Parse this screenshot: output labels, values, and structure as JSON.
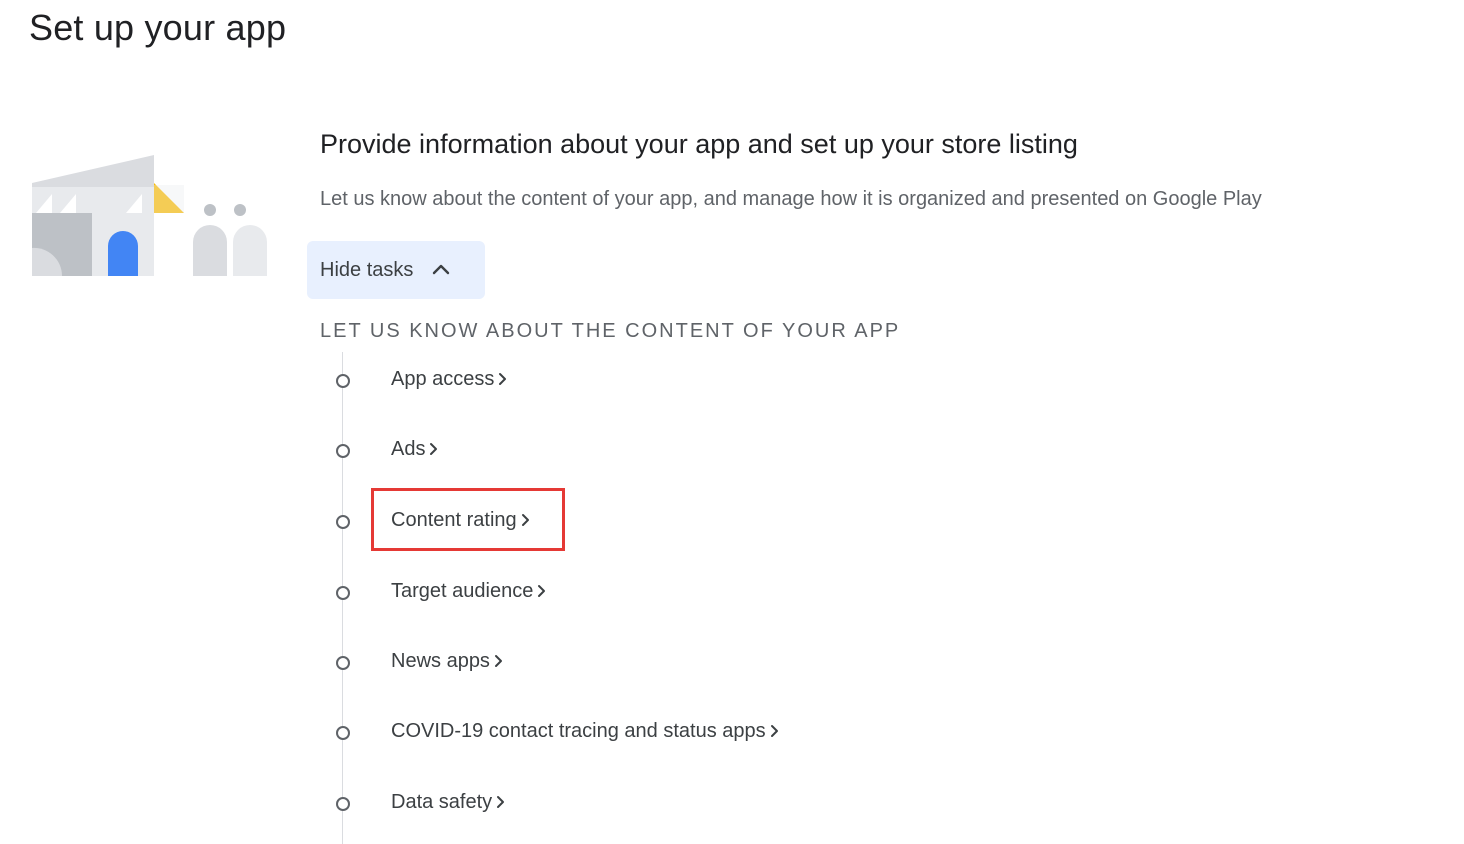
{
  "page": {
    "title": "Set up your app"
  },
  "section": {
    "heading": "Provide information about your app and set up your store listing",
    "description": "Let us know about the content of your app, and manage how it is organized and presented on Google Play",
    "hide_tasks_label": "Hide tasks",
    "hide_tasks_icon": "chevron-up-icon",
    "task_group_title": "LET US KNOW ABOUT THE CONTENT OF YOUR APP"
  },
  "tasks": [
    {
      "label": "App access",
      "status": "incomplete",
      "highlighted": false
    },
    {
      "label": "Ads",
      "status": "incomplete",
      "highlighted": false
    },
    {
      "label": "Content rating",
      "status": "incomplete",
      "highlighted": true
    },
    {
      "label": "Target audience",
      "status": "incomplete",
      "highlighted": false
    },
    {
      "label": "News apps",
      "status": "incomplete",
      "highlighted": false
    },
    {
      "label": "COVID-19 contact tracing and status apps",
      "status": "incomplete",
      "highlighted": false
    },
    {
      "label": "Data safety",
      "status": "incomplete",
      "highlighted": false
    }
  ],
  "colors": {
    "accent_bg": "#e8f0fe",
    "highlight_border": "#e53935",
    "illustration_blue": "#4285f4",
    "illustration_yellow": "#fbbc04",
    "illustration_grey": "#bdc1c6"
  },
  "icons": {
    "task_arrow": "chevron-right-icon",
    "task_status": "empty-circle-icon"
  }
}
